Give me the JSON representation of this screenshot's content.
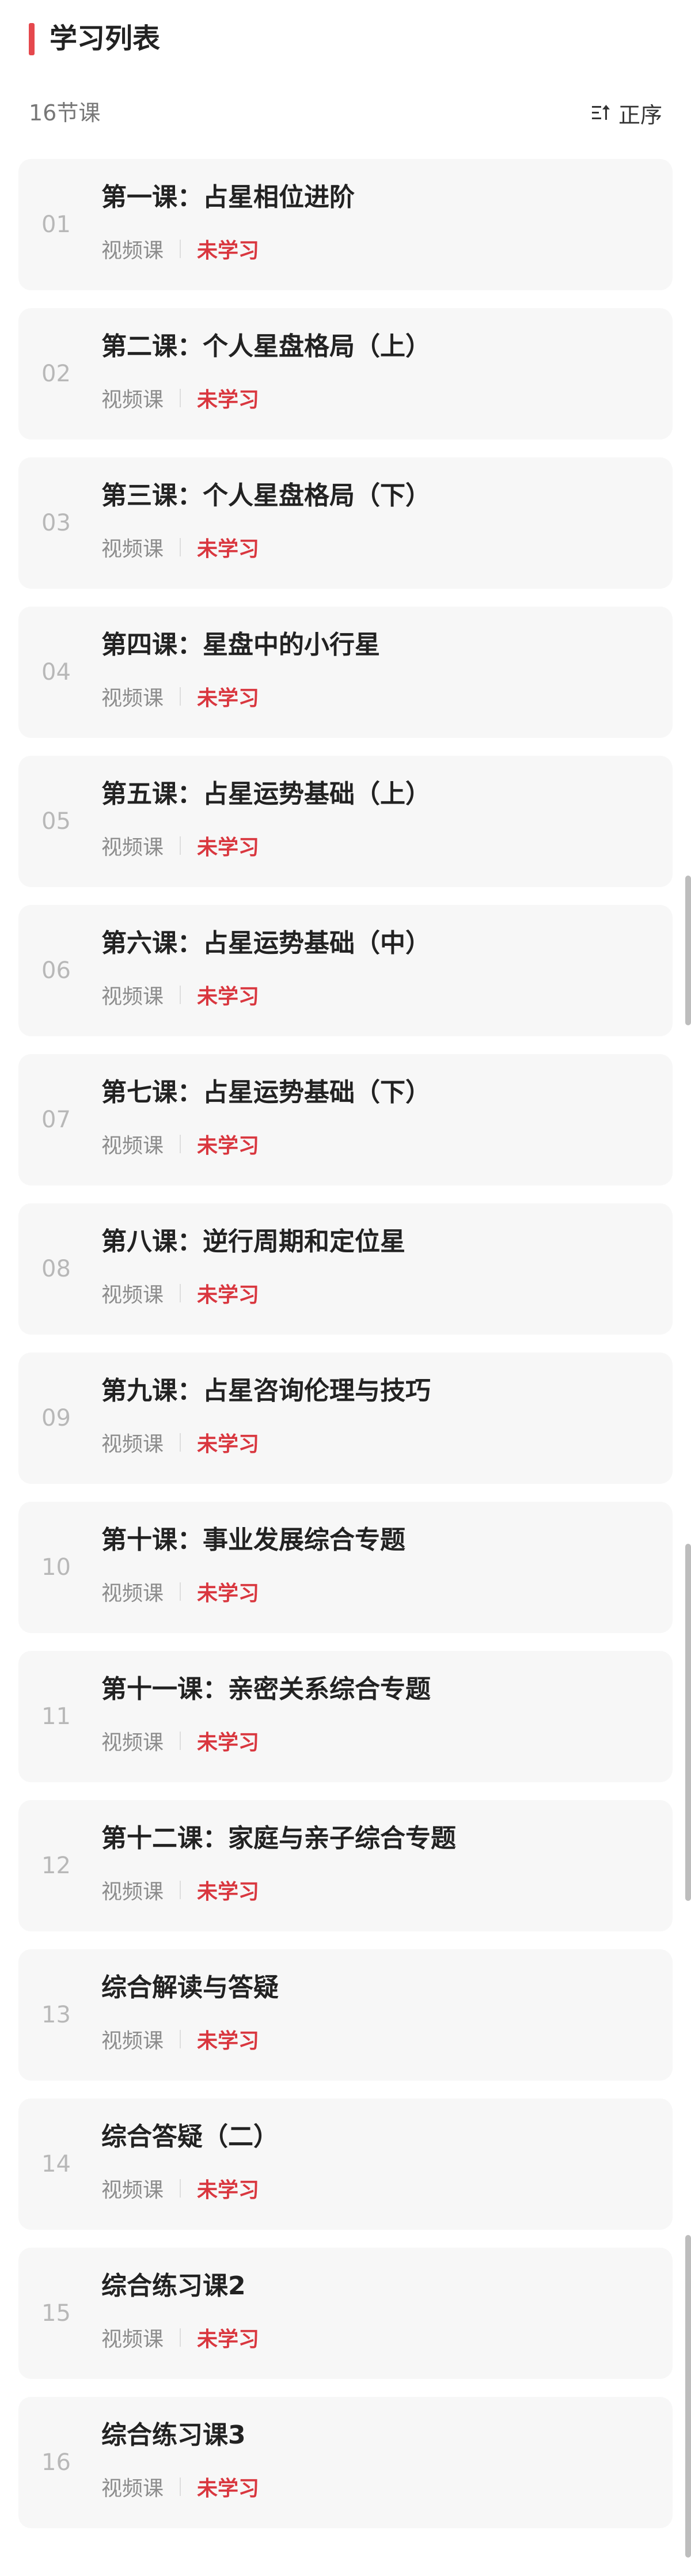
{
  "header": {
    "title": "学习列表"
  },
  "subbar": {
    "count_label": "16节课",
    "sort_label": "正序",
    "sort_icon": "sort-ascending-icon"
  },
  "colors": {
    "accent": "#e5484d",
    "status_unlearned": "#d9373f",
    "card_bg": "#f7f7f7"
  },
  "lessons": [
    {
      "num": "01",
      "title": "第一课：占星相位进阶",
      "type": "视频课",
      "status": "未学习"
    },
    {
      "num": "02",
      "title": "第二课：个人星盘格局（上）",
      "type": "视频课",
      "status": "未学习"
    },
    {
      "num": "03",
      "title": "第三课：个人星盘格局（下）",
      "type": "视频课",
      "status": "未学习"
    },
    {
      "num": "04",
      "title": "第四课：星盘中的小行星",
      "type": "视频课",
      "status": "未学习"
    },
    {
      "num": "05",
      "title": "第五课：占星运势基础（上）",
      "type": "视频课",
      "status": "未学习"
    },
    {
      "num": "06",
      "title": "第六课：占星运势基础（中）",
      "type": "视频课",
      "status": "未学习"
    },
    {
      "num": "07",
      "title": "第七课：占星运势基础（下）",
      "type": "视频课",
      "status": "未学习"
    },
    {
      "num": "08",
      "title": "第八课：逆行周期和定位星",
      "type": "视频课",
      "status": "未学习"
    },
    {
      "num": "09",
      "title": "第九课：占星咨询伦理与技巧",
      "type": "视频课",
      "status": "未学习"
    },
    {
      "num": "10",
      "title": "第十课：事业发展综合专题",
      "type": "视频课",
      "status": "未学习"
    },
    {
      "num": "11",
      "title": "第十一课：亲密关系综合专题",
      "type": "视频课",
      "status": "未学习"
    },
    {
      "num": "12",
      "title": "第十二课：家庭与亲子综合专题",
      "type": "视频课",
      "status": "未学习"
    },
    {
      "num": "13",
      "title": "综合解读与答疑",
      "type": "视频课",
      "status": "未学习"
    },
    {
      "num": "14",
      "title": "综合答疑（二）",
      "type": "视频课",
      "status": "未学习"
    },
    {
      "num": "15",
      "title": "综合练习课2",
      "type": "视频课",
      "status": "未学习"
    },
    {
      "num": "16",
      "title": "综合练习课3",
      "type": "视频课",
      "status": "未学习"
    }
  ]
}
